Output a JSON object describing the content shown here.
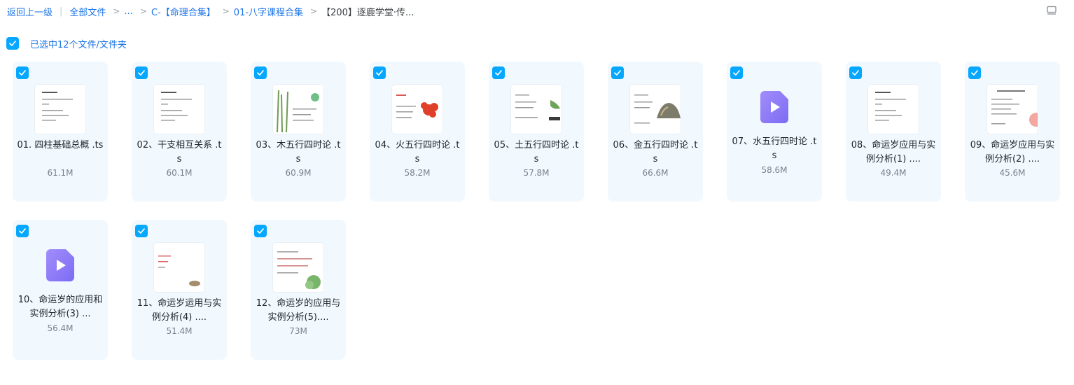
{
  "breadcrumb": {
    "back": "返回上一级",
    "all_files": "全部文件",
    "ellipsis": "...",
    "c1": "C-【命理合集】",
    "c2": "01-八字课程合集",
    "current": "【200】逐鹿学堂·传...",
    "list_view_icon": "list-view-icon"
  },
  "selection": {
    "label": "已选中12个文件/文件夹",
    "color": "#06a7ff"
  },
  "files": [
    {
      "name": "01. 四柱基础总概 .ts",
      "size": "61.1M",
      "thumb": "doc"
    },
    {
      "name": "02、干支相互关系 .ts",
      "size": "60.1M",
      "thumb": "doc"
    },
    {
      "name": "03、木五行四时论 .ts",
      "size": "60.9M",
      "thumb": "bamboo"
    },
    {
      "name": "04、火五行四时论 .ts",
      "size": "58.2M",
      "thumb": "flower"
    },
    {
      "name": "05、土五行四时论 .ts",
      "size": "57.8M",
      "thumb": "leaf"
    },
    {
      "name": "06、金五行四时论 .ts",
      "size": "66.6M",
      "thumb": "rock"
    },
    {
      "name": "07、水五行四时论 .ts",
      "size": "58.6M",
      "thumb": "video-icon"
    },
    {
      "name": "08、命运岁应用与实例分析(1) ....",
      "size": "49.4M",
      "thumb": "doc"
    },
    {
      "name": "09、命运岁应用与实例分析(2) ....",
      "size": "45.6M",
      "thumb": "doc-red"
    },
    {
      "name": "10、命运岁的应用和实例分析(3) ...",
      "size": "56.4M",
      "thumb": "video-icon"
    },
    {
      "name": "11、命运岁运用与实例分析(4) ....",
      "size": "51.4M",
      "thumb": "doc-stone"
    },
    {
      "name": "12、命运岁的应用与实例分析(5)....",
      "size": "73M",
      "thumb": "doc-lotus"
    }
  ],
  "colors": {
    "accent": "#06a7ff",
    "link": "#1a73e8",
    "card_bg": "#f1f9ff",
    "video_icon": "#8c7cf8"
  }
}
